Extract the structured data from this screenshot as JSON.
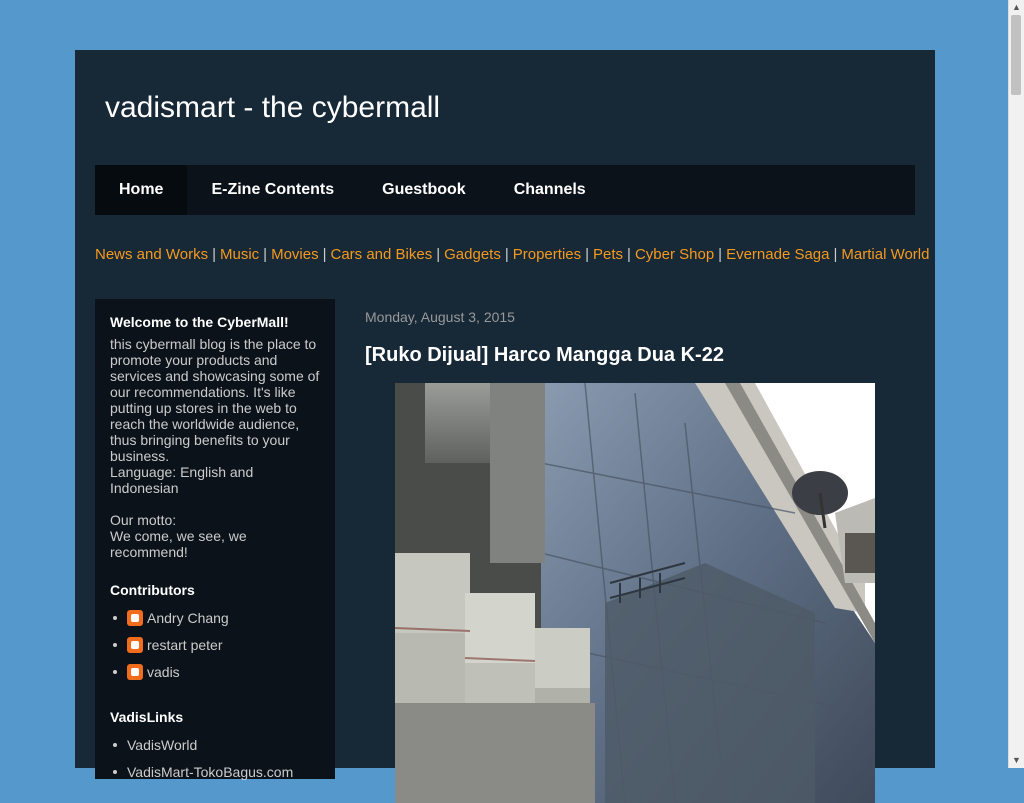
{
  "blog": {
    "title": "vadismart - the cybermall"
  },
  "tabs": [
    {
      "label": "Home"
    },
    {
      "label": "E-Zine Contents"
    },
    {
      "label": "Guestbook"
    },
    {
      "label": "Channels"
    }
  ],
  "linkbar": {
    "links": [
      {
        "label": "News and Works"
      },
      {
        "label": "Music"
      },
      {
        "label": "Movies"
      },
      {
        "label": "Cars and Bikes"
      },
      {
        "label": "Gadgets"
      },
      {
        "label": "Properties"
      },
      {
        "label": "Pets"
      },
      {
        "label": "Cyber Shop"
      },
      {
        "label": "Evernade Saga"
      },
      {
        "label": "Martial World"
      }
    ],
    "separator": "|"
  },
  "sidebar": {
    "welcome": {
      "title": "Welcome to the CyberMall!",
      "text": "this cybermall blog is the place to promote your products and services and showcasing some of our recommendations. It's like putting up stores in the web to reach the worldwide audience, thus bringing benefits to your business.\nLanguage: English and Indonesian\n\nOur motto:\nWe come, we see, we recommend!"
    },
    "contributors": {
      "title": "Contributors",
      "items": [
        {
          "name": "Andry Chang"
        },
        {
          "name": "restart peter"
        },
        {
          "name": "vadis"
        }
      ]
    },
    "links": {
      "title": "VadisLinks",
      "items": [
        {
          "label": "VadisWorld"
        },
        {
          "label": "VadisMart-TokoBagus.com"
        }
      ]
    }
  },
  "post": {
    "date": "Monday, August 3, 2015",
    "title": "[Ruko Dijual] Harco Mangga Dua K-22"
  },
  "colors": {
    "background": "#5599cc",
    "content_bg": "#172837",
    "sidebar_bg": "#0b1219",
    "link": "#f49a1e"
  }
}
